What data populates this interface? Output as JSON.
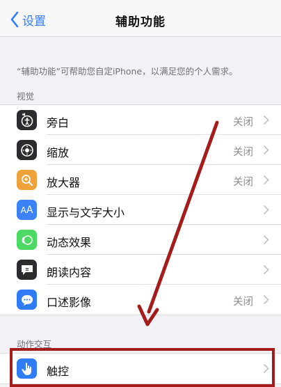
{
  "navbar": {
    "back_label": "设置",
    "title": "辅助功能"
  },
  "description": "“辅助功能”可帮助您自定iPhone，以满足您的个人需求。",
  "sections": [
    {
      "header": "视觉",
      "items": [
        {
          "label": "旁白",
          "value": "关闭",
          "icon": "voiceover-icon",
          "color": "#2c2c2e"
        },
        {
          "label": "缩放",
          "value": "关闭",
          "icon": "zoom-icon",
          "color": "#2c2c2e"
        },
        {
          "label": "放大器",
          "value": "关闭",
          "icon": "magnifier-icon",
          "color": "#f0a23a"
        },
        {
          "label": "显示与文字大小",
          "value": "",
          "icon": "text-size-icon",
          "color": "#3b82f6"
        },
        {
          "label": "动态效果",
          "value": "",
          "icon": "motion-icon",
          "color": "#4cd964"
        },
        {
          "label": "朗读内容",
          "value": "",
          "icon": "spoken-content-icon",
          "color": "#2c2c2e"
        },
        {
          "label": "口述影像",
          "value": "关闭",
          "icon": "audio-description-icon",
          "color": "#2f7cf6"
        }
      ]
    },
    {
      "header": "动作交互",
      "items": [
        {
          "label": "触控",
          "value": "",
          "icon": "touch-icon",
          "color": "#2f7cf6"
        }
      ]
    }
  ],
  "annotation_color": "#a41c1c",
  "accent_color": "#2f7cf6"
}
